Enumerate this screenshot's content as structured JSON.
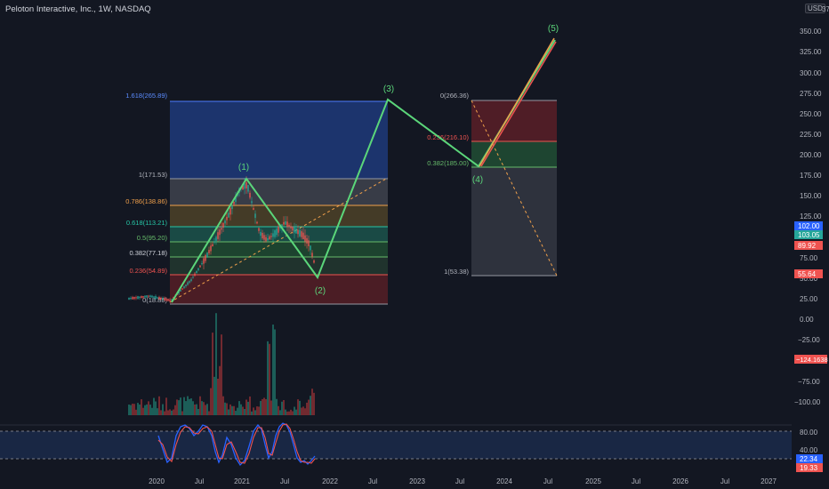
{
  "header": {
    "title": "Peloton Interactive, Inc., 1W, NASDAQ",
    "currency": "USD",
    "top_right_number": "37"
  },
  "colors": {
    "background": "#131722",
    "wave_green": "#5bd67a",
    "orange": "#f0a04b",
    "red_candle": "#ef5350",
    "green_candle": "#26a69a",
    "blue_box": "#1f3a7a",
    "stoch_blue": "#3b6cff"
  },
  "chart_data": {
    "type": "candlestick",
    "x_axis_labels": [
      "2020",
      "Jul",
      "2021",
      "Jul",
      "2022",
      "Jul",
      "2023",
      "Jul",
      "2024",
      "Jul",
      "2025",
      "Jul",
      "2026",
      "Jul",
      "2027"
    ],
    "price_axis_labels": [
      "350.00",
      "325.00",
      "300.00",
      "275.00",
      "250.00",
      "225.00",
      "200.00",
      "175.00",
      "150.00",
      "125.00",
      "75.00",
      "50.00",
      "25.00",
      "0.00",
      "−25.00",
      "−75.00",
      "−100.00"
    ],
    "price_axis_range": [
      -110,
      365
    ],
    "price_badges": [
      {
        "text": "102.00",
        "color": "#2962ff"
      },
      {
        "text": "103.05",
        "color": "#26a69a"
      },
      {
        "text": "89.92",
        "color": "#ef5350"
      },
      {
        "text": "55.64",
        "color": "#ef5350"
      },
      {
        "text": "−124.1638",
        "color": "#ef5350"
      }
    ],
    "fib_retracement_1": {
      "levels": [
        {
          "label": "1.618(265.89)",
          "price": 265.89,
          "label_color": "#5b8cff"
        },
        {
          "label": "1(171.53)",
          "price": 171.53,
          "label_color": "#b2b5be"
        },
        {
          "label": "0.786(138.86)",
          "price": 138.86,
          "label_color": "#f0a04b"
        },
        {
          "label": "0.618(113.21)",
          "price": 113.21,
          "label_color": "#26c6a6"
        },
        {
          "label": "0.5(95.20)",
          "price": 95.2,
          "label_color": "#66bb6a"
        },
        {
          "label": "0.382(77.18)",
          "price": 77.18,
          "label_color": "#d1d4dc"
        },
        {
          "label": "0.236(54.89)",
          "price": 54.89,
          "label_color": "#ef5350"
        },
        {
          "label": "0(18.88)",
          "price": 18.88,
          "label_color": "#b2b5be"
        }
      ]
    },
    "fib_retracement_2": {
      "levels": [
        {
          "label": "0(266.36)",
          "price": 266.36,
          "label_color": "#b2b5be"
        },
        {
          "label": "0.236(216.10)",
          "price": 216.1,
          "label_color": "#ef5350"
        },
        {
          "label": "0.382(185.00)",
          "price": 185.0,
          "label_color": "#66bb6a"
        },
        {
          "label": "1(53.38)",
          "price": 53.38,
          "label_color": "#b2b5be"
        }
      ]
    },
    "elliott_wave_labels": [
      "(1)",
      "(2)",
      "(3)",
      "(4)",
      "(5)"
    ],
    "stochastic": {
      "axis_labels": [
        "80.00",
        "40.00"
      ],
      "badges": [
        {
          "text": "22.34",
          "color": "#2962ff"
        },
        {
          "text": "19.33",
          "color": "#ef5350"
        }
      ]
    }
  }
}
